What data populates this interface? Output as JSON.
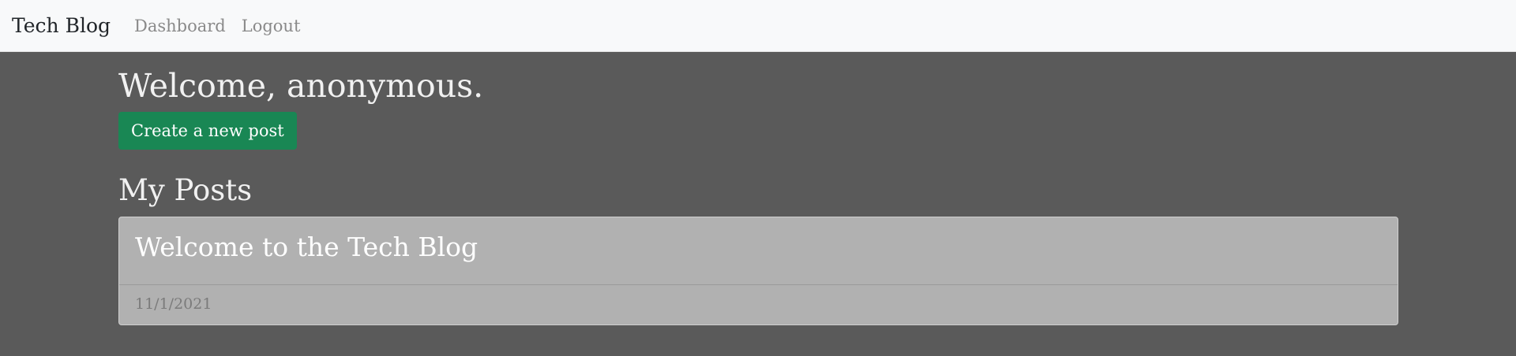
{
  "navbar": {
    "brand": "Tech Blog",
    "links": [
      {
        "label": "Dashboard"
      },
      {
        "label": "Logout"
      }
    ]
  },
  "main": {
    "welcome": "Welcome, anonymous.",
    "create_post_label": "Create a new post",
    "section_title": "My Posts",
    "posts": [
      {
        "title": "Welcome to the Tech Blog",
        "date": "11/1/2021"
      }
    ]
  },
  "colors": {
    "background": "#5a5a5a",
    "navbar": "#f8f9fa",
    "primary_button": "#198754",
    "card": "#b1b1b1"
  }
}
